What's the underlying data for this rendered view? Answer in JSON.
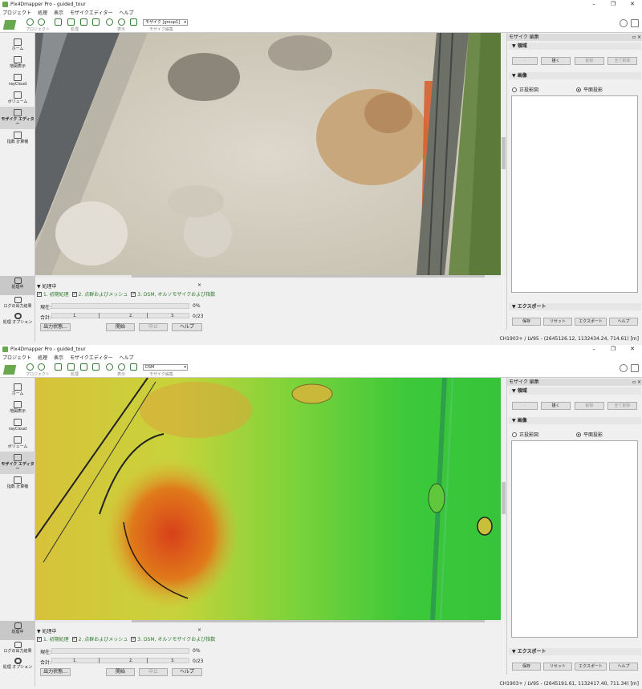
{
  "windows": [
    {
      "title": "Pix4Dmapper Pro - guided_tour",
      "menu": [
        "プロジェクト",
        "処理",
        "表示",
        "モザイクエディター",
        "ヘルプ"
      ],
      "toolbar_groups": [
        "プロジェクト",
        "処理",
        "表示",
        "モザイク編集"
      ],
      "mosaic_select": "モザイク [group1]",
      "sidebar": [
        "ホーム",
        "地図表示",
        "rayCloud",
        "ボリューム",
        "モザイク エディター",
        "指数 計算機"
      ],
      "processing_sidebar": [
        "処理中",
        "ログの出力結果",
        "処理 オプション"
      ],
      "processing": {
        "title": "処理中",
        "close": "×",
        "steps": [
          "1. 初期処理",
          "2. 点群およびメッシュ",
          "3. DSM, オルソモザイクおよび指数"
        ],
        "current_label": "現在:",
        "current_pct": "0%",
        "total_label": "合計:",
        "total_steps": [
          "1.",
          "2.",
          "3."
        ],
        "total_count": "0/23",
        "buttons": [
          "出力状態...",
          "開始",
          "中止",
          "ヘルプ"
        ]
      },
      "right_panel": {
        "title": "モザイク 編集",
        "section_region": "領域",
        "region_buttons": [
          "-",
          "描く",
          "削除",
          "全て削除"
        ],
        "section_images": "画像",
        "radios": [
          "正投影図",
          "平面投影"
        ],
        "selected_radio": 1,
        "section_export": "エクスポート",
        "export_buttons": [
          "保存",
          "リセット",
          "エクスポート",
          "ヘルプ"
        ]
      },
      "status": "CH1903+ / LV95 - (2645126.12, 1132434.24, 714.61) [m]"
    },
    {
      "title": "Pix4Dmapper Pro - guided_tour",
      "menu": [
        "プロジェクト",
        "処理",
        "表示",
        "モザイクエディター",
        "ヘルプ"
      ],
      "toolbar_groups": [
        "プロジェクト",
        "処理",
        "表示",
        "モザイク編集"
      ],
      "mosaic_select": "DSM",
      "sidebar": [
        "ホーム",
        "地図表示",
        "rayCloud",
        "ボリューム",
        "モザイク エディター",
        "指数 計算機"
      ],
      "processing_sidebar": [
        "処理中",
        "ログの出力結果",
        "処理 オプション"
      ],
      "processing": {
        "title": "処理中",
        "close": "×",
        "steps": [
          "1. 初期処理",
          "2. 点群およびメッシュ",
          "3. DSM, オルソモザイクおよび指数"
        ],
        "current_label": "現在:",
        "current_pct": "0%",
        "total_label": "合計:",
        "total_steps": [
          "1.",
          "2.",
          "3."
        ],
        "total_count": "0/23",
        "buttons": [
          "出力状態...",
          "開始",
          "中止",
          "ヘルプ"
        ]
      },
      "right_panel": {
        "title": "モザイク 編集",
        "section_region": "領域",
        "region_buttons": [
          "-",
          "描く",
          "削除",
          "全て削除"
        ],
        "section_images": "画像",
        "radios": [
          "正投影図",
          "平面投影"
        ],
        "selected_radio": 1,
        "section_export": "エクスポート",
        "export_buttons": [
          "保存",
          "リセット",
          "エクスポート",
          "ヘルプ"
        ]
      },
      "status": "CH1903+ / LV95 - (2645191.61, 1132417.40, 711.34) [m]"
    }
  ]
}
